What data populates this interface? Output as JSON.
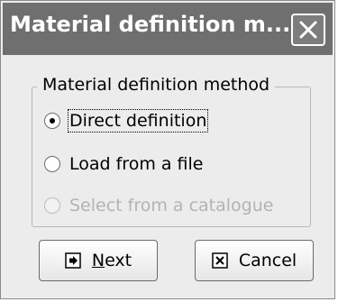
{
  "window": {
    "title": "Material definition m...",
    "close_icon": "close-icon"
  },
  "group": {
    "legend": "Material definition method",
    "options": [
      {
        "label": "Direct definition",
        "selected": true,
        "enabled": true,
        "focused": true
      },
      {
        "label": "Load from a file",
        "selected": false,
        "enabled": true,
        "focused": false
      },
      {
        "label": "Select from a catalogue",
        "selected": false,
        "enabled": false,
        "focused": false
      }
    ]
  },
  "buttons": {
    "next": {
      "label": "Next",
      "icon": "arrow-right-icon"
    },
    "cancel": {
      "label": "Cancel",
      "icon": "x-box-icon"
    }
  },
  "colors": {
    "titlebar": "#6f6f6f",
    "dialog_bg": "#ececec",
    "disabled_text": "#b3b3b3"
  }
}
